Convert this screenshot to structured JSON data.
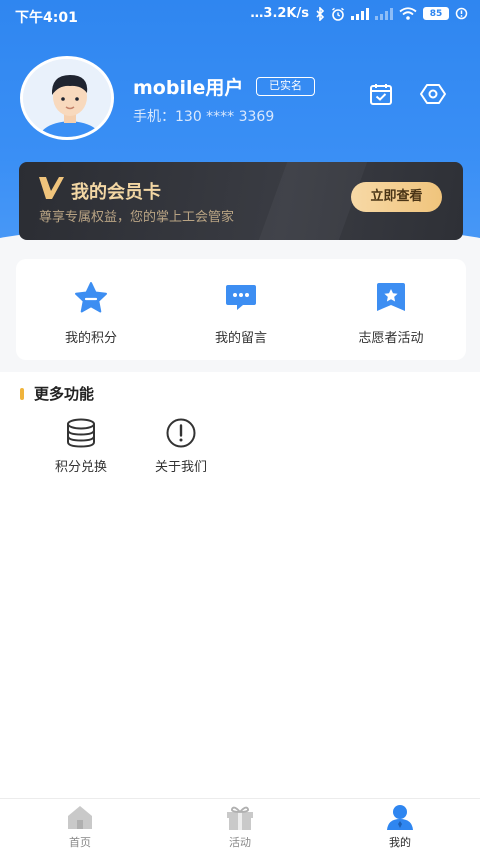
{
  "status_bar": {
    "time": "下午4:01",
    "network_speed": "…3.2K/s",
    "battery": "85"
  },
  "profile": {
    "username": "mobile用户",
    "verified_badge": "已实名",
    "phone": "手机：130 **** 3369"
  },
  "member_card": {
    "title": "我的会员卡",
    "subtitle": "尊享专属权益，您的掌上工会管家",
    "button": "立即查看"
  },
  "quick_actions": [
    {
      "label": "我的积分",
      "icon": "star-icon"
    },
    {
      "label": "我的留言",
      "icon": "message-icon"
    },
    {
      "label": "志愿者活动",
      "icon": "bookmark-star-icon"
    }
  ],
  "more_section": {
    "title": "更多功能",
    "items": [
      {
        "label": "积分兑换",
        "icon": "database-icon"
      },
      {
        "label": "关于我们",
        "icon": "info-circle-icon"
      }
    ]
  },
  "tab_bar": {
    "tabs": [
      {
        "label": "首页",
        "icon": "home-icon"
      },
      {
        "label": "活动",
        "icon": "gift-icon"
      },
      {
        "label": "我的",
        "icon": "user-icon"
      }
    ],
    "active": "我的"
  },
  "colors": {
    "primary": "#2f86f0",
    "gold": "#f0c47c",
    "accent_bar": "#f0b43c"
  }
}
